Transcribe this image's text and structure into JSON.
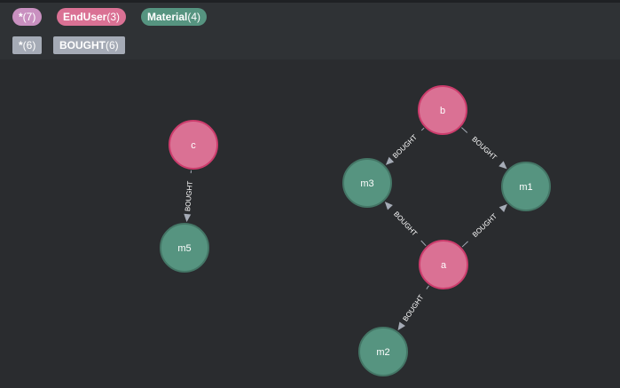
{
  "legend": {
    "labels": [
      {
        "name": "*",
        "count": "(7)",
        "color": "#c990c0"
      },
      {
        "name": "EndUser",
        "count": "(3)",
        "color": "#da7194"
      },
      {
        "name": "Material",
        "count": "(4)",
        "color": "#569480"
      }
    ],
    "relationships": [
      {
        "name": "*",
        "count": "(6)",
        "color": "#a5abb6"
      },
      {
        "name": "BOUGHT",
        "count": "(6)",
        "color": "#a5abb6"
      }
    ]
  },
  "graph": {
    "colors": {
      "enduser_fill": "#da7194",
      "enduser_stroke": "#cc3c6c",
      "material_fill": "#569480",
      "material_stroke": "#447666",
      "edge": "#a5abb6",
      "edge_label": "#ffffff"
    },
    "nodes": [
      {
        "id": "c",
        "label": "c",
        "type": "EndUser"
      },
      {
        "id": "m5",
        "label": "m5",
        "type": "Material"
      },
      {
        "id": "b",
        "label": "b",
        "type": "EndUser"
      },
      {
        "id": "m3",
        "label": "m3",
        "type": "Material"
      },
      {
        "id": "m1",
        "label": "m1",
        "type": "Material"
      },
      {
        "id": "a",
        "label": "a",
        "type": "EndUser"
      },
      {
        "id": "m2",
        "label": "m2",
        "type": "Material"
      }
    ],
    "edges": [
      {
        "from": "c",
        "to": "m5",
        "label": "BOUGHT"
      },
      {
        "from": "b",
        "to": "m3",
        "label": "BOUGHT"
      },
      {
        "from": "b",
        "to": "m1",
        "label": "BOUGHT"
      },
      {
        "from": "a",
        "to": "m3",
        "label": "BOUGHT"
      },
      {
        "from": "a",
        "to": "m1",
        "label": "BOUGHT"
      },
      {
        "from": "a",
        "to": "m2",
        "label": "BOUGHT"
      }
    ]
  }
}
